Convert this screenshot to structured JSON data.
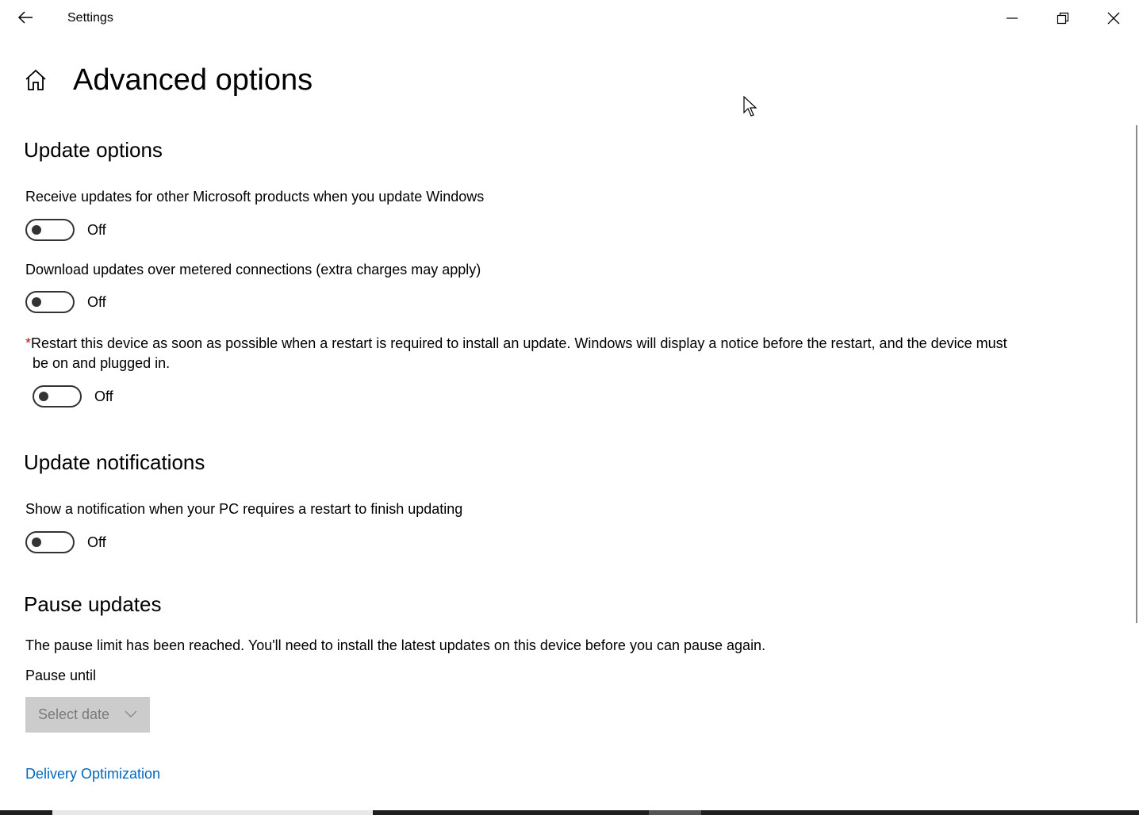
{
  "window": {
    "title": "Settings"
  },
  "header": {
    "page_title": "Advanced options"
  },
  "sections": {
    "update_options": {
      "title": "Update options",
      "settings": [
        {
          "label": "Receive updates for other Microsoft products when you update Windows",
          "state": "Off"
        },
        {
          "label": "Download updates over metered connections (extra charges may apply)",
          "state": "Off"
        },
        {
          "required_mark": "*",
          "label_line1": "Restart this device as soon as possible when a restart is required to install an update. Windows will display a notice before the restart, and the device must",
          "label_line2": "be on and plugged in.",
          "state": "Off"
        }
      ]
    },
    "update_notifications": {
      "title": "Update notifications",
      "settings": [
        {
          "label": "Show a notification when your PC requires a restart to finish updating",
          "state": "Off"
        }
      ]
    },
    "pause_updates": {
      "title": "Pause updates",
      "message": "The pause limit has been reached. You'll need to install the latest updates on this device before you can pause again.",
      "pause_until_label": "Pause until",
      "select_placeholder": "Select date"
    }
  },
  "links": {
    "delivery_optimization": "Delivery Optimization"
  },
  "colors": {
    "link": "#0067c0",
    "required": "#c50f1f",
    "disabled_select_bg": "#cccccc"
  },
  "icons": {
    "back": "back-arrow-icon",
    "home": "home-icon",
    "minimize": "minimize-icon",
    "restore": "restore-icon",
    "close": "close-icon",
    "chevron": "chevron-down-icon"
  }
}
